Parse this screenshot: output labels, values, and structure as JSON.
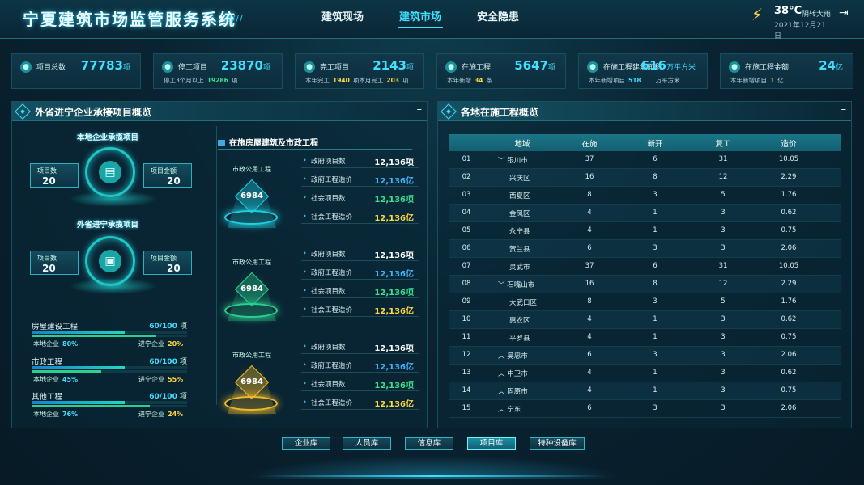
{
  "header": {
    "title": "宁夏建筑市场监管服务系统",
    "nav": [
      "建筑现场",
      "建筑市场",
      "安全隐患"
    ],
    "active_nav": "建筑市场",
    "weather": {
      "temp": "38°C",
      "desc": "阴转大雨",
      "date": "2021年12月21日",
      "icon": "thunderstorm-icon"
    }
  },
  "stats": [
    {
      "label": "项目总数",
      "value": "77783",
      "unit": "项",
      "sub": []
    },
    {
      "label": "停工项目",
      "value": "23870",
      "unit": "项",
      "sub": [
        {
          "t": "停工3个月以上"
        },
        {
          "v": "19286",
          "c": "g"
        },
        {
          "t": "项"
        }
      ]
    },
    {
      "label": "完工项目",
      "value": "2143",
      "unit": "项",
      "sub": [
        {
          "t": "本年完工"
        },
        {
          "v": "1940"
        },
        {
          "t": "项"
        },
        {
          "t": "本月完工"
        },
        {
          "v": "203"
        },
        {
          "t": "项"
        }
      ]
    },
    {
      "label": "在施工程",
      "value": "5647",
      "unit": "项",
      "sub": [
        {
          "t": "本年新增"
        },
        {
          "v": "34"
        },
        {
          "t": "条"
        }
      ]
    },
    {
      "label": "在施工程建筑面积",
      "value": "616",
      "unit": "万平方米",
      "sub": [
        {
          "t": "本年新增项目"
        },
        {
          "v": "518",
          "c": "c"
        },
        {
          "t": "万平方米"
        }
      ]
    },
    {
      "label": "在施工程金额",
      "value": "24",
      "unit": "亿",
      "sub": [
        {
          "t": "本年新增项目"
        },
        {
          "v": "1"
        },
        {
          "t": "亿"
        }
      ]
    }
  ],
  "left_panel": {
    "title": "外省进宁企业承接项目概览",
    "local": {
      "title": "本地企业承揽项目",
      "count_label": "项目数",
      "count": "20",
      "amount_label": "项目金额",
      "amount": "20"
    },
    "outside": {
      "title": "外省进宁承揽项目",
      "count_label": "项目数",
      "count": "20",
      "amount_label": "项目金额",
      "amount": "20"
    },
    "bars": [
      {
        "name": "房屋建设工程",
        "ratio": "60/100",
        "unit": "项",
        "fraction": 0.6,
        "local_label": "本地企业",
        "local_pct": "80%",
        "outside_label": "进宁企业",
        "outside_pct": "20%"
      },
      {
        "name": "市政工程",
        "ratio": "60/100",
        "unit": "项",
        "fraction": 0.6,
        "local_label": "本地企业",
        "local_pct": "45%",
        "outside_label": "进宁企业",
        "outside_pct": "55%"
      },
      {
        "name": "其他工程",
        "ratio": "60/100",
        "unit": "项",
        "fraction": 0.6,
        "local_label": "本地企业",
        "local_pct": "76%",
        "outside_label": "进宁企业",
        "outside_pct": "24%"
      }
    ],
    "sub_title": "在施房屋建筑及市政工程",
    "groups": [
      {
        "label": "市政公用工程",
        "number": "6984",
        "color": "#20d0e0",
        "items": [
          {
            "k": "政府项目数",
            "v": "12,136项",
            "color": "#ffffff"
          },
          {
            "k": "政府工程造价",
            "v": "12,136亿",
            "color": "#3fb4ff"
          },
          {
            "k": "社会项目数",
            "v": "12,136项",
            "color": "#39e38f"
          },
          {
            "k": "社会工程造价",
            "v": "12,136亿",
            "color": "#ffd83d"
          }
        ]
      },
      {
        "label": "市政公用工程",
        "number": "6984",
        "color": "#2bd08e",
        "items": [
          {
            "k": "政府项目数",
            "v": "12,136项",
            "color": "#ffffff"
          },
          {
            "k": "政府工程造价",
            "v": "12,136亿",
            "color": "#3fb4ff"
          },
          {
            "k": "社会项目数",
            "v": "12,136项",
            "color": "#39e38f"
          },
          {
            "k": "社会工程造价",
            "v": "12,136亿",
            "color": "#ffd83d"
          }
        ]
      },
      {
        "label": "市政公用工程",
        "number": "6984",
        "color": "#f0b92a",
        "items": [
          {
            "k": "政府项目数",
            "v": "12,136项",
            "color": "#ffffff"
          },
          {
            "k": "政府工程造价",
            "v": "12,136亿",
            "color": "#3fb4ff"
          },
          {
            "k": "社会项目数",
            "v": "12,136项",
            "color": "#39e38f"
          },
          {
            "k": "社会工程造价",
            "v": "12,136亿",
            "color": "#ffd83d"
          }
        ]
      }
    ]
  },
  "right_panel": {
    "title": "各地在施工程概览",
    "columns": [
      "地域",
      "在施",
      "新开",
      "复工",
      "造价"
    ],
    "rows": [
      [
        "01",
        "﹀ 银川市",
        "37",
        "6",
        "31",
        "10.05"
      ],
      [
        "02",
        "兴庆区",
        "16",
        "8",
        "12",
        "2.29"
      ],
      [
        "03",
        "西夏区",
        "8",
        "3",
        "5",
        "1.76"
      ],
      [
        "04",
        "金凤区",
        "4",
        "1",
        "3",
        "0.62"
      ],
      [
        "05",
        "永宁县",
        "4",
        "1",
        "3",
        "0.75"
      ],
      [
        "06",
        "贺兰县",
        "6",
        "3",
        "3",
        "2.06"
      ],
      [
        "07",
        "灵武市",
        "37",
        "6",
        "31",
        "10.05"
      ],
      [
        "08",
        "﹀ 石嘴山市",
        "16",
        "8",
        "12",
        "2.29"
      ],
      [
        "09",
        "大武口区",
        "8",
        "3",
        "5",
        "1.76"
      ],
      [
        "10",
        "惠农区",
        "4",
        "1",
        "3",
        "0.62"
      ],
      [
        "11",
        "平罗县",
        "4",
        "1",
        "3",
        "0.75"
      ],
      [
        "12",
        "︿ 吴忠市",
        "6",
        "3",
        "3",
        "2.06"
      ],
      [
        "13",
        "︿ 中卫市",
        "4",
        "1",
        "3",
        "0.62"
      ],
      [
        "14",
        "︿ 固原市",
        "4",
        "1",
        "3",
        "0.75"
      ],
      [
        "15",
        "︿ 宁东",
        "6",
        "3",
        "3",
        "2.06"
      ]
    ]
  },
  "tabs": [
    "企业库",
    "人员库",
    "信息库",
    "项目库",
    "特种设备库"
  ],
  "active_tab": "项目库"
}
